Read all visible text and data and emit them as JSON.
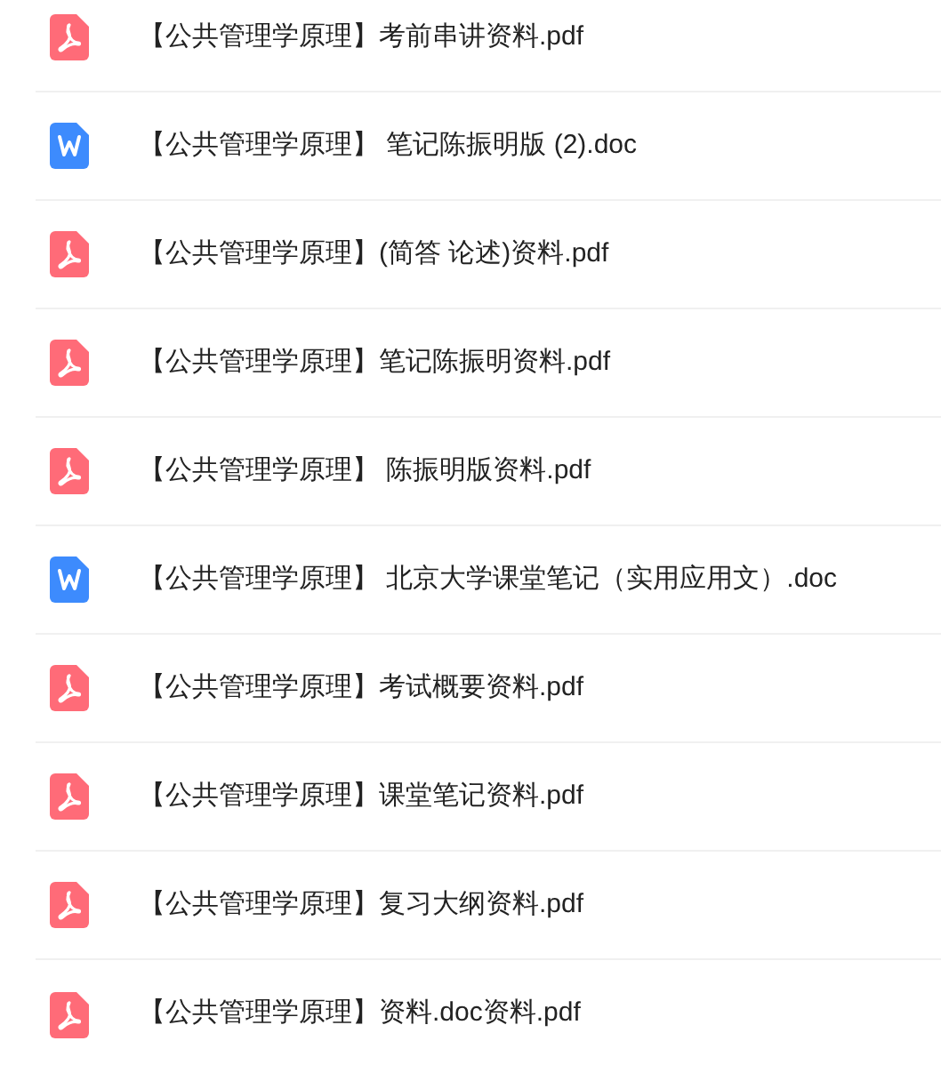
{
  "files": [
    {
      "kind": "pdf",
      "name": "【公共管理学原理】考前串讲资料.pdf"
    },
    {
      "kind": "doc",
      "name": "【公共管理学原理】 笔记陈振明版 (2).doc"
    },
    {
      "kind": "pdf",
      "name": "【公共管理学原理】(简答 论述)资料.pdf"
    },
    {
      "kind": "pdf",
      "name": "【公共管理学原理】笔记陈振明资料.pdf"
    },
    {
      "kind": "pdf",
      "name": "【公共管理学原理】 陈振明版资料.pdf"
    },
    {
      "kind": "doc",
      "name": "【公共管理学原理】 北京大学课堂笔记（实用应用文）.doc"
    },
    {
      "kind": "pdf",
      "name": "【公共管理学原理】考试概要资料.pdf"
    },
    {
      "kind": "pdf",
      "name": "【公共管理学原理】课堂笔记资料.pdf"
    },
    {
      "kind": "pdf",
      "name": "【公共管理学原理】复习大纲资料.pdf"
    },
    {
      "kind": "pdf",
      "name": "【公共管理学原理】资料.doc资料.pdf"
    }
  ]
}
